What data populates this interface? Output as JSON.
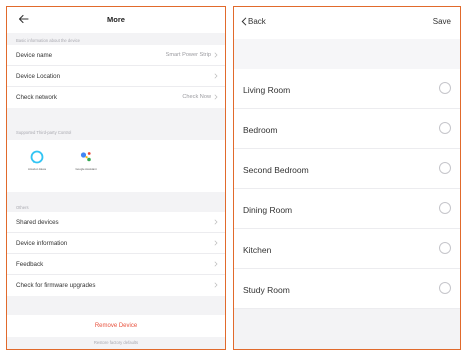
{
  "left": {
    "title": "More",
    "sections": {
      "basic_caption": "Basic information about the device",
      "thirdparty_caption": "Supported Third-party Control",
      "others_caption": "Others"
    },
    "basic_rows": [
      {
        "label": "Device name",
        "value": "Smart Power Strip"
      },
      {
        "label": "Device Location",
        "value": ""
      },
      {
        "label": "Check network",
        "value": "Check Now"
      }
    ],
    "third_party": [
      {
        "name": "Amazon Alexa",
        "icon": "alexa-icon"
      },
      {
        "name": "Google Assistant",
        "icon": "google-assistant-icon"
      }
    ],
    "other_rows": [
      {
        "label": "Shared devices"
      },
      {
        "label": "Device information"
      },
      {
        "label": "Feedback"
      },
      {
        "label": "Check for firmware upgrades"
      }
    ],
    "remove_label": "Remove Device",
    "restore_label": "Restore factory defaults"
  },
  "right": {
    "back_label": "Back",
    "save_label": "Save",
    "rooms": [
      {
        "label": "Living Room"
      },
      {
        "label": "Bedroom"
      },
      {
        "label": "Second Bedroom"
      },
      {
        "label": "Dining Room"
      },
      {
        "label": "Kitchen"
      },
      {
        "label": "Study Room"
      }
    ]
  },
  "colors": {
    "frame": "#e16a2c",
    "danger": "#e8513d",
    "alexa": "#31c4f3",
    "google_blue": "#4285f4",
    "google_red": "#ea4335",
    "google_yellow": "#fbbc05",
    "google_green": "#34a853"
  }
}
